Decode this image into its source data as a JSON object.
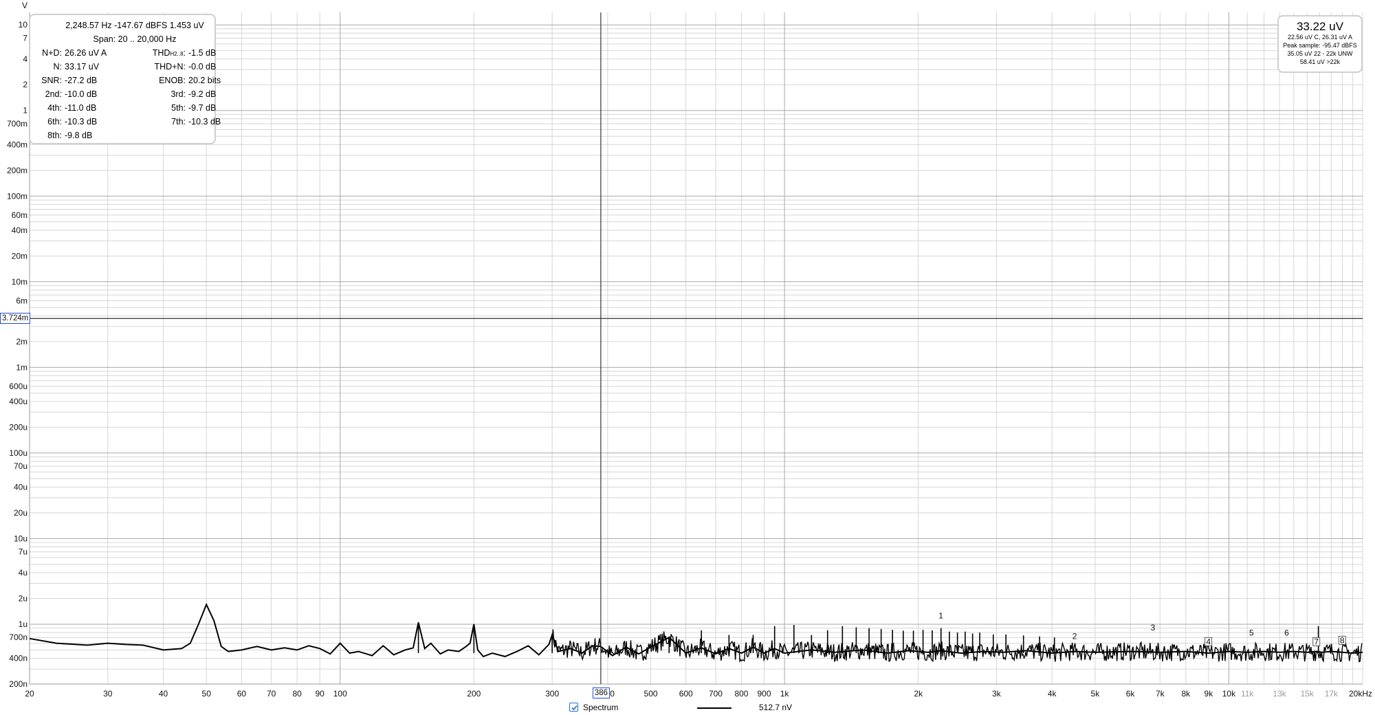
{
  "window": {
    "y_unit": "V",
    "x_unit_tick": "20kHz"
  },
  "stats": {
    "cursor_readout": "2,248.57 Hz  -147.67 dBFS  1.453 uV",
    "span": "Span: 20 .. 20,000 Hz",
    "rows": [
      {
        "l1": "N+D:",
        "v1": "26.26 uV A",
        "l2": "THD",
        "l2sub": "H2..8",
        "l2tail": ":",
        "v2": "-1.5 dB"
      },
      {
        "l1": "N:",
        "v1": "33.17 uV",
        "l2": "THD+N:",
        "l2sub": "",
        "l2tail": "",
        "v2": "-0.0 dB"
      },
      {
        "l1": "SNR:",
        "v1": "-27.2 dB",
        "l2": "ENOB:",
        "l2sub": "",
        "l2tail": "",
        "v2": "20.2 bits"
      },
      {
        "l1": "2nd:",
        "v1": "-10.0 dB",
        "l2": "3rd:",
        "l2sub": "",
        "l2tail": "",
        "v2": "-9.2 dB"
      },
      {
        "l1": "4th:",
        "v1": "-11.0 dB",
        "l2": "5th:",
        "l2sub": "",
        "l2tail": "",
        "v2": "-9.7 dB"
      },
      {
        "l1": "6th:",
        "v1": "-10.3 dB",
        "l2": "7th:",
        "l2sub": "",
        "l2tail": "",
        "v2": "-10.3 dB"
      },
      {
        "l1": "8th:",
        "v1": "-9.8 dB",
        "l2": "",
        "l2sub": "",
        "l2tail": "",
        "v2": ""
      }
    ]
  },
  "meter": {
    "main": "33.22 uV",
    "line1": "22.56 uV C, 26.31 uV A",
    "line2": "Peak sample: -95.47 dBFS",
    "line3": "35.05 uV 22 - 22k UNW",
    "line4": "58.41 uV >22k"
  },
  "cursor": {
    "y_label": "3.724m",
    "x_label": "386",
    "y_value": 0.003724,
    "x_value": 386
  },
  "legend": {
    "checkbox_checked": true,
    "series_label": "Spectrum",
    "level": "512.7 nV"
  },
  "colors": {
    "trace": "#000000",
    "grid_minor": "#d6d6d6",
    "grid_major": "#a8a8a8",
    "cursor_box": "#1e4ed8"
  },
  "chart_data": {
    "type": "line",
    "title": "",
    "xlabel": "",
    "ylabel": "V",
    "x_scale": "log",
    "y_scale": "log",
    "xlim": [
      20,
      20000
    ],
    "ylim": [
      2e-07,
      14
    ],
    "grid": true,
    "legend": "bottom-center",
    "x_tick_labels": [
      {
        "v": 20,
        "t": "20"
      },
      {
        "v": 30,
        "t": "30"
      },
      {
        "v": 40,
        "t": "40"
      },
      {
        "v": 50,
        "t": "50"
      },
      {
        "v": 60,
        "t": "60"
      },
      {
        "v": 70,
        "t": "70"
      },
      {
        "v": 80,
        "t": "80"
      },
      {
        "v": 90,
        "t": "90"
      },
      {
        "v": 100,
        "t": "100"
      },
      {
        "v": 200,
        "t": "200"
      },
      {
        "v": 300,
        "t": "300"
      },
      {
        "v": 400,
        "t": "400"
      },
      {
        "v": 500,
        "t": "500"
      },
      {
        "v": 600,
        "t": "600"
      },
      {
        "v": 700,
        "t": "700"
      },
      {
        "v": 800,
        "t": "800"
      },
      {
        "v": 900,
        "t": "900"
      },
      {
        "v": 1000,
        "t": "1k"
      },
      {
        "v": 2000,
        "t": "2k"
      },
      {
        "v": 3000,
        "t": "3k"
      },
      {
        "v": 4000,
        "t": "4k"
      },
      {
        "v": 5000,
        "t": "5k"
      },
      {
        "v": 6000,
        "t": "6k"
      },
      {
        "v": 7000,
        "t": "7k"
      },
      {
        "v": 8000,
        "t": "8k"
      },
      {
        "v": 9000,
        "t": "9k"
      },
      {
        "v": 10000,
        "t": "10k"
      },
      {
        "v": 11000,
        "t": "11k",
        "faint": true
      },
      {
        "v": 13000,
        "t": "13k",
        "faint": true
      },
      {
        "v": 15000,
        "t": "15k",
        "faint": true
      },
      {
        "v": 17000,
        "t": "17k",
        "faint": true
      },
      {
        "v": 20000,
        "t": "20kHz"
      }
    ],
    "y_tick_labels": [
      {
        "v": 10,
        "t": "10"
      },
      {
        "v": 7,
        "t": "7"
      },
      {
        "v": 4,
        "t": "4"
      },
      {
        "v": 2,
        "t": "2"
      },
      {
        "v": 1,
        "t": "1"
      },
      {
        "v": 0.7,
        "t": "700m"
      },
      {
        "v": 0.4,
        "t": "400m"
      },
      {
        "v": 0.2,
        "t": "200m"
      },
      {
        "v": 0.1,
        "t": "100m"
      },
      {
        "v": 0.06,
        "t": "60m"
      },
      {
        "v": 0.04,
        "t": "40m"
      },
      {
        "v": 0.02,
        "t": "20m"
      },
      {
        "v": 0.01,
        "t": "10m"
      },
      {
        "v": 0.006,
        "t": "6m"
      },
      {
        "v": 0.002,
        "t": "2m"
      },
      {
        "v": 0.001,
        "t": "1m"
      },
      {
        "v": 0.0006,
        "t": "600u"
      },
      {
        "v": 0.0004,
        "t": "400u"
      },
      {
        "v": 0.0002,
        "t": "200u"
      },
      {
        "v": 0.0001,
        "t": "100u"
      },
      {
        "v": 7e-05,
        "t": "70u"
      },
      {
        "v": 4e-05,
        "t": "40u"
      },
      {
        "v": 2e-05,
        "t": "20u"
      },
      {
        "v": 1e-05,
        "t": "10u"
      },
      {
        "v": 7e-06,
        "t": "7u"
      },
      {
        "v": 4e-06,
        "t": "4u"
      },
      {
        "v": 2e-06,
        "t": "2u"
      },
      {
        "v": 1e-06,
        "t": "1u"
      },
      {
        "v": 7e-07,
        "t": "700n"
      },
      {
        "v": 4e-07,
        "t": "400n"
      },
      {
        "v": 2e-07,
        "t": "200n"
      }
    ],
    "series": [
      {
        "x": [
          20,
          23,
          27,
          30,
          33,
          36,
          40,
          44,
          46,
          48,
          50,
          52,
          54,
          56,
          60,
          65,
          70,
          75,
          80,
          85,
          90,
          95,
          100,
          105,
          110,
          118,
          125,
          132,
          140,
          146,
          150,
          155,
          160,
          168,
          175,
          185,
          192,
          196,
          200,
          204,
          210,
          220,
          235,
          250,
          265,
          280,
          295,
          300,
          310,
          330,
          350,
          370,
          386,
          410,
          440,
          470,
          500,
          550,
          600,
          650,
          700,
          750,
          800,
          850,
          900,
          950,
          1000,
          1150,
          1300,
          1500,
          1700,
          1900,
          2100,
          2250,
          2500,
          2800,
          3100,
          3500,
          4000,
          4500,
          5000,
          6000,
          7000,
          8000,
          9000,
          10000,
          11000,
          12000,
          13000,
          14000,
          15000,
          15900,
          16200,
          17000,
          18000,
          19000,
          20000
        ],
        "y": [
          6.8e-07,
          6e-07,
          5.7e-07,
          6e-07,
          5.8e-07,
          5.7e-07,
          5e-07,
          5.2e-07,
          6e-07,
          1e-06,
          1.7e-06,
          1.1e-06,
          5.5e-07,
          4.8e-07,
          5e-07,
          5.5e-07,
          5e-07,
          5.3e-07,
          5e-07,
          5.6e-07,
          5.2e-07,
          4.5e-07,
          6e-07,
          4.6e-07,
          4.8e-07,
          4.3e-07,
          5.6e-07,
          4.4e-07,
          5e-07,
          5.3e-07,
          1.05e-06,
          5.2e-07,
          6e-07,
          4.5e-07,
          5e-07,
          4.8e-07,
          5.5e-07,
          6e-07,
          1e-06,
          5e-07,
          4.2e-07,
          4.6e-07,
          4.2e-07,
          4.8e-07,
          5.6e-07,
          4.4e-07,
          5.8e-07,
          7.5e-07,
          4.8e-07,
          5.2e-07,
          4.6e-07,
          5.6e-07,
          5.5e-07,
          4.3e-07,
          5.4e-07,
          4.5e-07,
          5.4e-07,
          7e-07,
          4.6e-07,
          5.3e-07,
          4.5e-07,
          5.2e-07,
          4.6e-07,
          5.4e-07,
          4.6e-07,
          5.2e-07,
          4.6e-07,
          5e-07,
          4.7e-07,
          5e-07,
          4.6e-07,
          4.9e-07,
          4.7e-07,
          4.9e-07,
          4.6e-07,
          4.8e-07,
          4.7e-07,
          4.9e-07,
          4.6e-07,
          4.8e-07,
          4.7e-07,
          4.8e-07,
          4.7e-07,
          4.8e-07,
          4.6e-07,
          4.8e-07,
          4.7e-07,
          4.8e-07,
          4.7e-07,
          4.8e-07,
          4.7e-07,
          4.8e-07,
          4.7e-07,
          4.8e-07,
          4.7e-07,
          4.6e-07,
          4.7e-07
        ]
      }
    ],
    "spurs": [
      {
        "x": 150,
        "y": 1.05e-06
      },
      {
        "x": 200,
        "y": 1e-06
      },
      {
        "x": 300,
        "y": 7.5e-07
      },
      {
        "x": 550,
        "y": 7e-07
      },
      {
        "x": 650,
        "y": 8.5e-07
      },
      {
        "x": 750,
        "y": 7.5e-07
      },
      {
        "x": 850,
        "y": 7.5e-07
      },
      {
        "x": 950,
        "y": 9.5e-07
      },
      {
        "x": 1050,
        "y": 9.8e-07
      },
      {
        "x": 1150,
        "y": 7.5e-07
      },
      {
        "x": 1250,
        "y": 8.5e-07
      },
      {
        "x": 1350,
        "y": 9.5e-07
      },
      {
        "x": 1450,
        "y": 9.2e-07
      },
      {
        "x": 1550,
        "y": 9e-07
      },
      {
        "x": 1650,
        "y": 8.8e-07
      },
      {
        "x": 1750,
        "y": 8.6e-07
      },
      {
        "x": 1850,
        "y": 8.4e-07
      },
      {
        "x": 1950,
        "y": 8.4e-07
      },
      {
        "x": 2050,
        "y": 8.6e-07
      },
      {
        "x": 2150,
        "y": 8.5e-07
      },
      {
        "x": 2250,
        "y": 9e-07
      },
      {
        "x": 2350,
        "y": 8.2e-07
      },
      {
        "x": 2450,
        "y": 8e-07
      },
      {
        "x": 2550,
        "y": 8.2e-07
      },
      {
        "x": 2650,
        "y": 7.8e-07
      },
      {
        "x": 2750,
        "y": 8e-07
      },
      {
        "x": 2950,
        "y": 7.6e-07
      },
      {
        "x": 3150,
        "y": 7.6e-07
      },
      {
        "x": 3450,
        "y": 7.4e-07
      },
      {
        "x": 3750,
        "y": 7.2e-07
      },
      {
        "x": 4050,
        "y": 7e-07
      },
      {
        "x": 15900,
        "y": 9.5e-07
      }
    ],
    "harmonic_markers": [
      {
        "label": "1",
        "x": 2249,
        "y": 1.05e-06
      },
      {
        "label": "2",
        "x": 4497,
        "y": 6e-07
      },
      {
        "label": "3",
        "x": 6746,
        "y": 7.6e-07
      },
      {
        "label": "4",
        "x": 8994,
        "y": 5.2e-07
      },
      {
        "label": "5",
        "x": 11243,
        "y": 6.6e-07
      },
      {
        "label": "6",
        "x": 13491,
        "y": 6.6e-07
      },
      {
        "label": "7",
        "x": 15740,
        "y": 5.2e-07
      },
      {
        "label": "8",
        "x": 17989,
        "y": 5.4e-07
      }
    ]
  }
}
